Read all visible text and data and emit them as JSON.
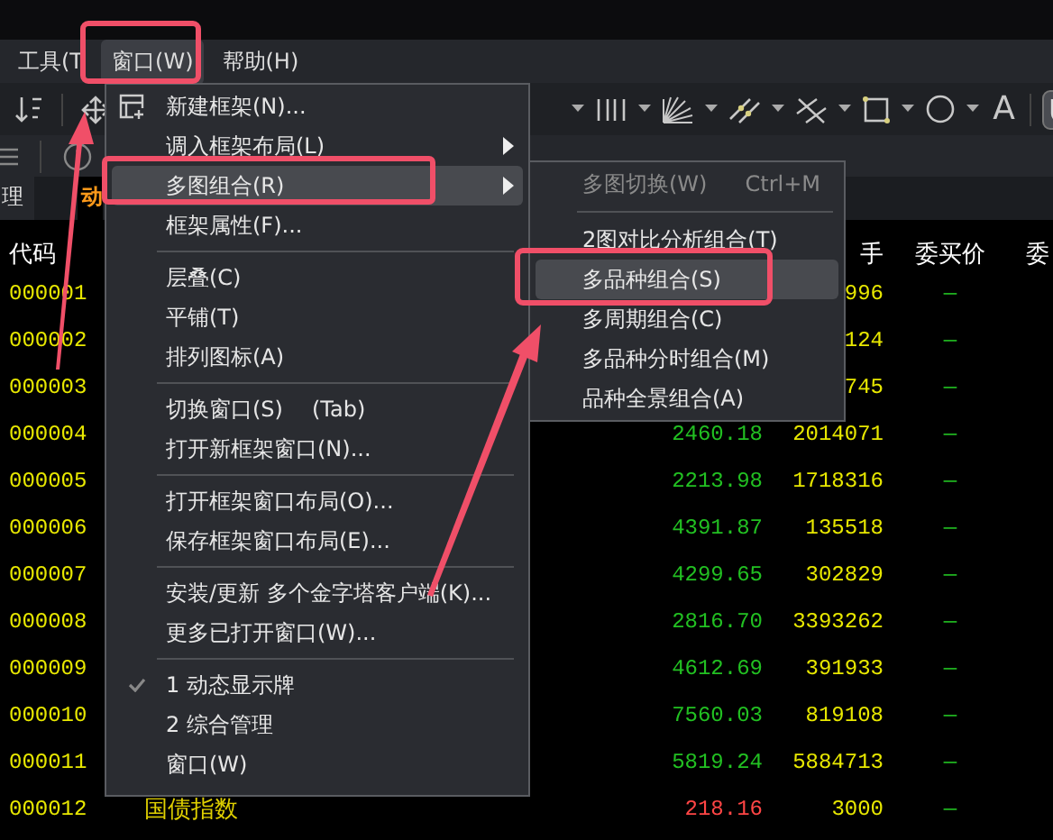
{
  "menubar": [
    {
      "label": "工具(T",
      "selected": false
    },
    {
      "label": "窗口(W)",
      "selected": true
    },
    {
      "label": "帮助(H)",
      "selected": false
    }
  ],
  "toolbar": {
    "text_tool": "A"
  },
  "tabs": [
    {
      "label": "理",
      "selected": false
    },
    {
      "label": "动",
      "selected": true
    }
  ],
  "table": {
    "columns": [
      "代码",
      "手",
      "委买价",
      "委"
    ],
    "rows": [
      {
        "code": "000001",
        "volume": "996",
        "bid": "—"
      },
      {
        "code": "000002",
        "volume": "124",
        "bid": "—"
      },
      {
        "code": "000003",
        "volume": "745",
        "bid": "—"
      },
      {
        "code": "000004",
        "price": "2460.18",
        "color": "#22c022",
        "volume": "2014071",
        "bid": "—"
      },
      {
        "code": "000005",
        "price": "2213.98",
        "color": "#22c022",
        "volume": "1718316",
        "bid": "—"
      },
      {
        "code": "000006",
        "price": "4391.87",
        "color": "#22c022",
        "volume": "135518",
        "bid": "—"
      },
      {
        "code": "000007",
        "price": "4299.65",
        "color": "#22c022",
        "volume": "302829",
        "bid": "—"
      },
      {
        "code": "000008",
        "price": "2816.70",
        "color": "#22c022",
        "volume": "3393262",
        "bid": "—"
      },
      {
        "code": "000009",
        "price": "4612.69",
        "color": "#22c022",
        "volume": "391933",
        "bid": "—"
      },
      {
        "code": "000010",
        "price": "7560.03",
        "color": "#22c022",
        "volume": "819108",
        "bid": "—"
      },
      {
        "code": "000011",
        "price": "5819.24",
        "color": "#22c022",
        "volume": "5884713",
        "bid": "—"
      },
      {
        "code": "000012",
        "name": "国债指数",
        "price": "218.16",
        "color": "#ff4545",
        "volume": "3000",
        "bid": "—"
      }
    ]
  },
  "window_menu": {
    "items": [
      {
        "kind": "item",
        "label": "新建框架(N)...",
        "icon": true,
        "selected": false,
        "checked": false
      },
      {
        "kind": "item",
        "label": "调入框架布局(L)",
        "has_submenu": true,
        "selected": false,
        "checked": false
      },
      {
        "kind": "item",
        "label": "多图组合(R)",
        "has_submenu": true,
        "selected": true,
        "checked": false
      },
      {
        "kind": "item",
        "label": "框架属性(F)...",
        "selected": false,
        "checked": false
      },
      {
        "kind": "separator"
      },
      {
        "kind": "item",
        "label": "层叠(C)",
        "selected": false,
        "checked": false
      },
      {
        "kind": "item",
        "label": "平铺(T)",
        "selected": false,
        "checked": false
      },
      {
        "kind": "item",
        "label": "排列图标(A)",
        "selected": false,
        "checked": false
      },
      {
        "kind": "separator"
      },
      {
        "kind": "item",
        "label": "切换窗口(S)",
        "shortcut": "(Tab)",
        "selected": false,
        "checked": false
      },
      {
        "kind": "item",
        "label": "打开新框架窗口(N)...",
        "selected": false,
        "checked": false
      },
      {
        "kind": "separator"
      },
      {
        "kind": "item",
        "label": "打开框架窗口布局(O)...",
        "selected": false,
        "checked": false
      },
      {
        "kind": "item",
        "label": "保存框架窗口布局(E)...",
        "selected": false,
        "checked": false
      },
      {
        "kind": "separator"
      },
      {
        "kind": "item",
        "label": "安装/更新 多个金字塔客户端(K)...",
        "selected": false,
        "checked": false
      },
      {
        "kind": "item",
        "label": "更多已打开窗口(W)...",
        "selected": false,
        "checked": false
      },
      {
        "kind": "separator"
      },
      {
        "kind": "item",
        "label": "1 动态显示牌",
        "selected": false,
        "checked": true
      },
      {
        "kind": "item",
        "label": "2 综合管理",
        "selected": false,
        "checked": false
      },
      {
        "kind": "item",
        "label": "窗口(W)",
        "selected": false,
        "checked": false
      }
    ]
  },
  "multi_chart_submenu": {
    "items": [
      {
        "kind": "item",
        "label": "多图切换(W)",
        "shortcut": "Ctrl+M",
        "disabled": true,
        "selected": false
      },
      {
        "kind": "separator"
      },
      {
        "kind": "item",
        "label": "2图对比分析组合(T)",
        "disabled": false,
        "selected": false
      },
      {
        "kind": "item",
        "label": "多品种组合(S)",
        "disabled": false,
        "selected": true
      },
      {
        "kind": "item",
        "label": "多周期组合(C)",
        "disabled": false,
        "selected": false
      },
      {
        "kind": "item",
        "label": "多品种分时组合(M)",
        "disabled": false,
        "selected": false
      },
      {
        "kind": "item",
        "label": "品种全景组合(A)",
        "disabled": false,
        "selected": false
      }
    ]
  }
}
